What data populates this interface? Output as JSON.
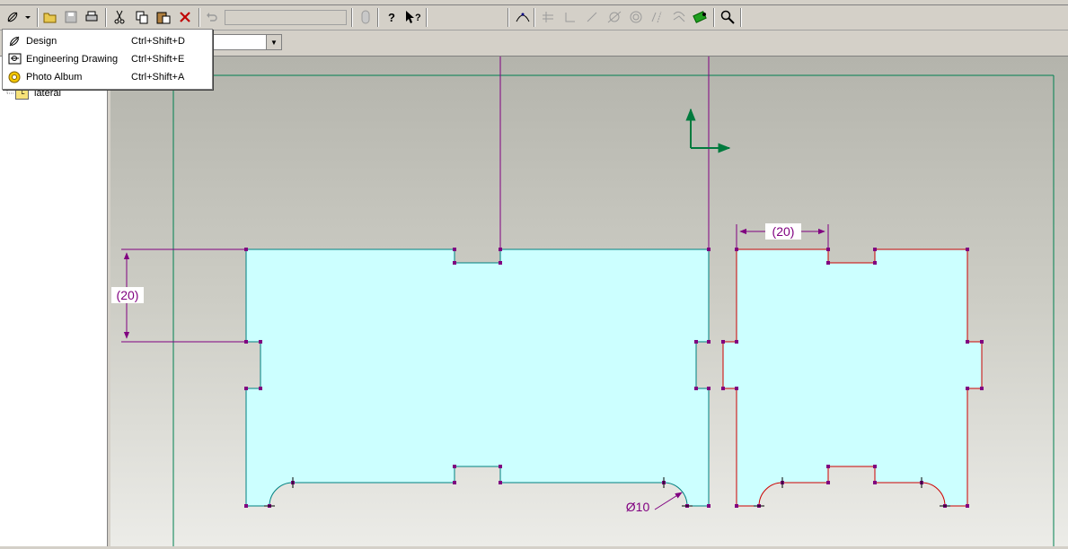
{
  "toolbar": {
    "mode_icon": "design-mode-icon",
    "open_icon": "open-folder-icon",
    "save_icon": "save-icon",
    "print_icon": "print-icon",
    "cut_icon": "cut-icon",
    "copy_icon": "copy-icon",
    "paste_icon": "paste-icon",
    "delete_icon": "delete-icon",
    "undo_icon": "undo-icon",
    "help_icon": "help-icon",
    "whats_this_icon": "whats-this-icon",
    "zoom_icon": "zoom-icon"
  },
  "mode_menu": {
    "items": [
      {
        "label": "Design",
        "shortcut": "Ctrl+Shift+D",
        "icon": "design-icon"
      },
      {
        "label": "Engineering Drawing",
        "shortcut": "Ctrl+Shift+E",
        "icon": "engineering-drawing-icon"
      },
      {
        "label": "Photo Album",
        "shortcut": "Ctrl+Shift+A",
        "icon": "photo-album-icon"
      }
    ]
  },
  "tree": {
    "items": [
      {
        "label": "lateral",
        "icon": "sketch-icon"
      }
    ]
  },
  "drawing": {
    "dimensions": {
      "left_vertical": "(20)",
      "right_horizontal": "(20)",
      "diameter": "Ø10"
    },
    "colors": {
      "fill": "#ccffff",
      "left_outline": "#008080",
      "right_outline": "#cc0000",
      "dimension": "#800080",
      "axis": "#007a3d",
      "frame": "#008050"
    }
  }
}
